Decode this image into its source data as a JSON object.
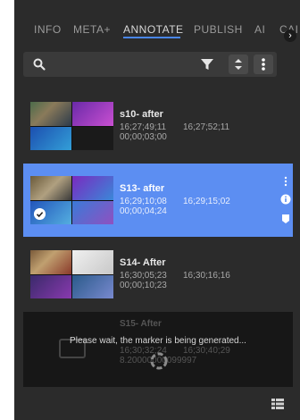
{
  "tabs": [
    {
      "label": "INFO",
      "active": false
    },
    {
      "label": "META+",
      "active": false
    },
    {
      "label": "ANNOTATE",
      "active": true
    },
    {
      "label": "PUBLISH",
      "active": false
    },
    {
      "label": "AI",
      "active": false
    },
    {
      "label": "CAI",
      "active": false
    }
  ],
  "icons": {
    "search": "search-icon",
    "filter": "filter-icon",
    "sort": "sort-icon",
    "more": "more-vertical-icon",
    "tab_next": "chevron-right-icon",
    "info": "info-icon",
    "tag": "tag-icon",
    "check": "check-icon",
    "spinner": "spinner-icon",
    "grid": "grid-view-icon"
  },
  "colors": {
    "panel_bg": "#2b2b2b",
    "selected_row": "#5c8ef2",
    "active_tab_underline": "#4a86e8"
  },
  "annotations": [
    {
      "title": "s10- after",
      "start_tc": "16;27;49;11",
      "end_tc": "16;27;52;11",
      "duration": "00;00;03;00",
      "selected": false
    },
    {
      "title": "S13- after",
      "start_tc": "16;29;10;08",
      "end_tc": "16;29;15;02",
      "duration": "00;00;04;24",
      "selected": true
    },
    {
      "title": "S14- After",
      "start_tc": "16;30;05;23",
      "end_tc": "16;30;16;16",
      "duration": "00;00;10;23",
      "selected": false
    }
  ],
  "generating_item": {
    "title": "S15- After",
    "start_tc": "16;30;32;24",
    "end_tc": "16;30;40;29",
    "duration": "8.20000000099997"
  },
  "overlay": {
    "message": "Please wait, the marker is being generated..."
  }
}
